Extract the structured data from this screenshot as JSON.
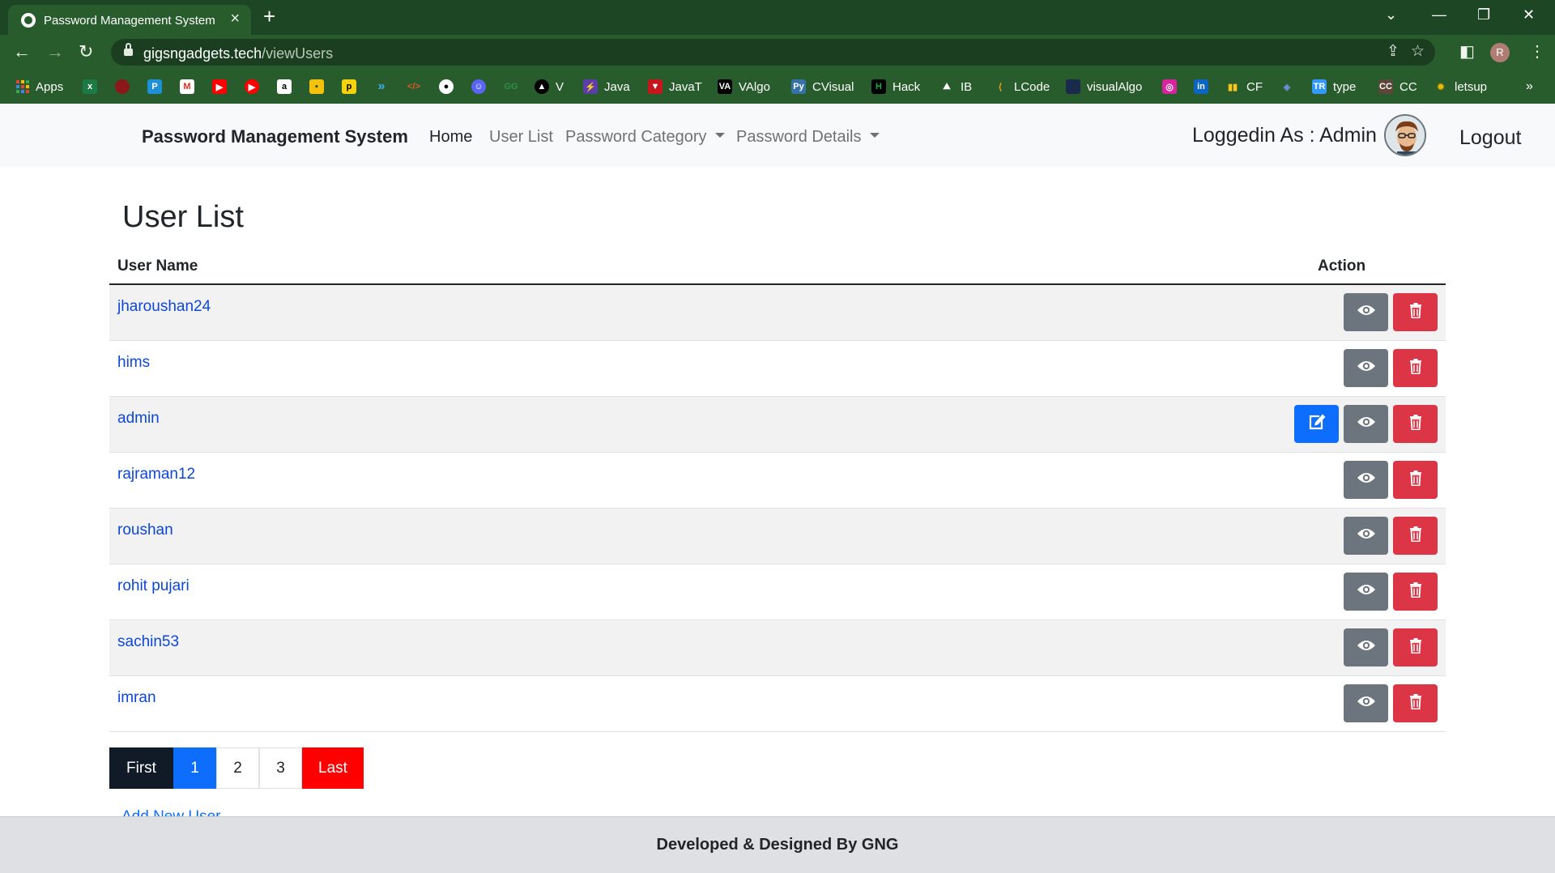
{
  "browser": {
    "tab_title": "Password Management System",
    "url_host": "gigsngadgets.tech",
    "url_path": "/viewUsers",
    "profile_initial": "R",
    "bookmarks": [
      {
        "label": "Apps",
        "icon": "apps-grid-icon"
      },
      {
        "label": "",
        "icon": "excel-icon",
        "color": "#1d7a45"
      },
      {
        "label": "",
        "icon": "redhat-icon",
        "color": "#8a1a1a"
      },
      {
        "label": "",
        "icon": "pwa-icon",
        "color": "#1f8fd6"
      },
      {
        "label": "",
        "icon": "gmail-icon",
        "color": "#d93025"
      },
      {
        "label": "",
        "icon": "youtube-icon",
        "color": "#ff0000"
      },
      {
        "label": "",
        "icon": "youtube-music-icon",
        "color": "#ff0000"
      },
      {
        "label": "",
        "icon": "amazon-icon",
        "color": "#ffffff"
      },
      {
        "label": "",
        "icon": "keep-icon",
        "color": "#f4c20d"
      },
      {
        "label": "",
        "icon": "p-icon",
        "color": "#f4d20d"
      },
      {
        "label": "",
        "icon": "vscode-icon",
        "color": "#1f8fd6"
      },
      {
        "label": "",
        "icon": "code-icon",
        "color": "#e0582b"
      },
      {
        "label": "",
        "icon": "github-icon",
        "color": "#ffffff"
      },
      {
        "label": "",
        "icon": "discord-icon",
        "color": "#5865f2"
      },
      {
        "label": "",
        "icon": "gfg-icon",
        "color": "#2f8d46"
      },
      {
        "label": "V",
        "icon": "vercel-icon",
        "color": "#000000"
      },
      {
        "label": "Java",
        "icon": "java-icon",
        "color": "#5b3ea8"
      },
      {
        "label": "JavaT",
        "icon": "javat-icon",
        "color": "#c4161c"
      },
      {
        "label": "VAlgo",
        "icon": "valgo-icon",
        "color": "#000000"
      },
      {
        "label": "CVisual",
        "icon": "python-icon",
        "color": "#3572a5"
      },
      {
        "label": "Hack",
        "icon": "hackerrank-icon",
        "color": "#000000"
      },
      {
        "label": "IB",
        "icon": "interviewbit-icon",
        "color": "#1e88e5"
      },
      {
        "label": "LCode",
        "icon": "leetcode-icon",
        "color": "#ffa116"
      },
      {
        "label": "visualAlgo",
        "icon": "visualalgo-icon",
        "color": "#1a2a4a"
      },
      {
        "label": "",
        "icon": "instagram-icon",
        "color": "#d6249f"
      },
      {
        "label": "",
        "icon": "linkedin-icon",
        "color": "#0a66c2"
      },
      {
        "label": "CF",
        "icon": "codeforces-icon",
        "color": "#1e88e5"
      },
      {
        "label": "",
        "icon": "link-icon",
        "color": "#3a5fb0"
      },
      {
        "label": "type",
        "icon": "typeracer-icon",
        "color": "#3399ff"
      },
      {
        "label": "CC",
        "icon": "codechef-icon",
        "color": "#5b4638"
      },
      {
        "label": "letsup",
        "icon": "letsup-icon",
        "color": "#f0b400"
      }
    ]
  },
  "navbar": {
    "brand": "Password Management System",
    "home": "Home",
    "user_list": "User List",
    "password_category": "Password Category",
    "password_details": "Password Details",
    "logged_in": "Loggedin As : Admin",
    "logout": "Logout"
  },
  "page": {
    "title": "User List",
    "columns": {
      "user_name": "User Name",
      "action": "Action"
    },
    "users": [
      {
        "name": "jharoushan24",
        "editable": false
      },
      {
        "name": "hims",
        "editable": false
      },
      {
        "name": "admin",
        "editable": true
      },
      {
        "name": "rajraman12",
        "editable": false
      },
      {
        "name": "roushan",
        "editable": false
      },
      {
        "name": "rohit pujari",
        "editable": false
      },
      {
        "name": "sachin53",
        "editable": false
      },
      {
        "name": "imran",
        "editable": false
      }
    ],
    "pagination": {
      "first": "First",
      "pages": [
        "1",
        "2",
        "3"
      ],
      "active": "1",
      "last": "Last"
    },
    "add_link": "Add New User"
  },
  "footer": {
    "text": "Developed & Designed By GNG"
  },
  "colors": {
    "chrome": "#285c2c",
    "link": "#0d47d9",
    "danger": "#dc3545",
    "secondary": "#6c757d",
    "primary": "#0d6efd"
  }
}
